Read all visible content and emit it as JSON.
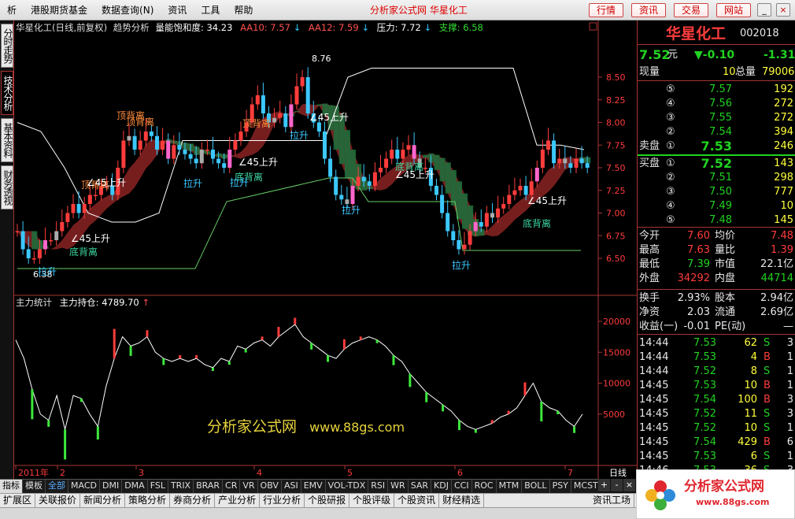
{
  "menu": {
    "items": [
      "析",
      "港股期货基金",
      "数据查询(N)",
      "资讯",
      "工具",
      "帮助"
    ],
    "title": "分析家公式网 华星化工",
    "buttons": [
      "行情",
      "资讯",
      "交易",
      "网站"
    ],
    "window_controls": [
      "_",
      "□",
      "×"
    ]
  },
  "vtabs": [
    "分时走势",
    "技术分析",
    "基本资料",
    "财务透视"
  ],
  "chart_header": {
    "name": "华星化工(日线,前复权)",
    "indicator": "趋势分析",
    "energy_label": "量能饱和度:",
    "energy_value": "34.23",
    "aa10_label": "AA10:",
    "aa10_value": "7.57",
    "aa12_label": "AA12:",
    "aa12_value": "7.59",
    "pressure_label": "压力:",
    "pressure_value": "7.72",
    "support_label": "支撑:",
    "support_value": "6.58",
    "down_arrow": "↓"
  },
  "sub_header": {
    "name": "主力统计",
    "label": "主力持仓:",
    "value": "4789.70",
    "up_arrow": "↑"
  },
  "watermark": {
    "cn": "分析家公式网",
    "url": "www.88gs.com"
  },
  "chart_data": {
    "type": "candlestick",
    "price_axis": {
      "ticks": [
        "8.50",
        "8.25",
        "8.00",
        "7.75",
        "7.50",
        "7.25",
        "7.00",
        "6.75",
        "6.50"
      ],
      "ylim": [
        6.4,
        8.85
      ]
    },
    "sub_axis": {
      "ticks": [
        "20000",
        "15000",
        "10000",
        "5000"
      ],
      "ylim": [
        0,
        23000
      ]
    },
    "x_ticks": [
      "2011年",
      "2",
      "3",
      "4",
      "5",
      "6",
      "7"
    ],
    "period_label": "日线",
    "high_label": "8.76",
    "low_label": "6.38",
    "annotations": {
      "top_div": [
        "顶背离",
        "顶背离",
        "顶背离",
        "顶背离"
      ],
      "bottom_div": [
        "底背离",
        "底背离",
        "底背离",
        "底背离"
      ],
      "pull_up": [
        "拉升",
        "拉升",
        "拉升",
        "拉升",
        "拉升",
        "拉升"
      ],
      "rise45": [
        "∠45上升",
        "∠45上升",
        "∠45上升",
        "∠45上升",
        "∠45上升",
        "∠45上升"
      ]
    },
    "closes": [
      6.8,
      6.6,
      6.5,
      6.5,
      6.6,
      6.7,
      6.7,
      6.8,
      6.9,
      7.0,
      7.1,
      7.0,
      7.1,
      7.2,
      7.2,
      7.3,
      7.3,
      7.2,
      7.5,
      7.8,
      7.85,
      7.7,
      7.8,
      7.9,
      7.85,
      7.7,
      7.8,
      7.6,
      7.75,
      7.7,
      7.65,
      7.6,
      7.55,
      7.7,
      7.7,
      7.6,
      7.55,
      7.5,
      7.7,
      7.8,
      7.9,
      8.0,
      8.2,
      8.3,
      8.1,
      8.0,
      8.05,
      8.1,
      7.95,
      8.2,
      8.4,
      8.5,
      8.1,
      8.0,
      7.9,
      7.6,
      7.4,
      7.2,
      7.15,
      7.1,
      7.3,
      7.4,
      7.35,
      7.3,
      7.45,
      7.5,
      7.6,
      7.7,
      7.6,
      7.7,
      7.75,
      7.6,
      7.5,
      7.5,
      7.3,
      7.2,
      7.0,
      6.8,
      6.7,
      6.6,
      6.65,
      6.8,
      6.9,
      6.85,
      7.0,
      6.95,
      7.05,
      7.1,
      7.2,
      7.25,
      7.3,
      7.2,
      7.35,
      7.5,
      7.7,
      7.8,
      7.55,
      7.6,
      7.55,
      7.5,
      7.6,
      7.55,
      7.5
    ],
    "sub_values": [
      17000,
      14000,
      9000,
      5000,
      4000,
      8000,
      2500,
      8000,
      7500,
      5000,
      3000,
      9500,
      14000,
      17500,
      16000,
      16500,
      17500,
      15000,
      14000,
      13500,
      14000,
      13500,
      14000,
      13000,
      12500,
      14000,
      13500,
      16000,
      15500,
      16500,
      17000,
      16000,
      17500,
      18500,
      19500,
      17500,
      16500,
      15500,
      14500,
      14000,
      15500,
      16500,
      17000,
      17500,
      17000,
      16000,
      14500,
      13500,
      11500,
      10000,
      8500,
      7500,
      6500,
      5500,
      4000,
      3000,
      2500,
      3000,
      3500,
      4500,
      5000,
      6000,
      8000,
      10000,
      7000,
      6000,
      5500,
      4000,
      3000,
      5000
    ],
    "ma_high": [
      8.0,
      7.9,
      7.5,
      7.0,
      6.9,
      6.9,
      7.0,
      7.8,
      7.8,
      7.8,
      7.8,
      7.8,
      7.8,
      7.8,
      8.5,
      8.6,
      8.6,
      8.6,
      8.6,
      8.6,
      8.6,
      8.6,
      7.75,
      7.75,
      7.7
    ]
  },
  "quote": {
    "name": "华星化工",
    "code": "002018",
    "price": "7.52",
    "unit": "元",
    "change": "▼-0.10",
    "pct": "-1.31",
    "vol_now_label": "现量",
    "vol_now": "10",
    "vol_total_label": "总量",
    "vol_total": "79006",
    "sell_label": "卖盘",
    "buy_label": "买盘",
    "asks": [
      {
        "n": "⑤",
        "p": "7.57",
        "v": "192"
      },
      {
        "n": "④",
        "p": "7.56",
        "v": "272"
      },
      {
        "n": "③",
        "p": "7.55",
        "v": "272"
      },
      {
        "n": "②",
        "p": "7.54",
        "v": "394"
      },
      {
        "n": "①",
        "p": "7.53",
        "v": "246"
      }
    ],
    "bids": [
      {
        "n": "①",
        "p": "7.52",
        "v": "143"
      },
      {
        "n": "②",
        "p": "7.51",
        "v": "298"
      },
      {
        "n": "③",
        "p": "7.50",
        "v": "777"
      },
      {
        "n": "④",
        "p": "7.49",
        "v": "10"
      },
      {
        "n": "⑤",
        "p": "7.48",
        "v": "145"
      }
    ],
    "stats": [
      {
        "l1": "今开",
        "v1": "7.60",
        "l2": "均价",
        "v2": "7.48",
        "c1": "red",
        "c2": "red"
      },
      {
        "l1": "最高",
        "v1": "7.63",
        "l2": "量比",
        "v2": "1.39",
        "c1": "red",
        "c2": "red"
      },
      {
        "l1": "最低",
        "v1": "7.39",
        "l2": "市值",
        "v2": "22.1亿",
        "c1": "green",
        "c2": "white"
      },
      {
        "l1": "外盘",
        "v1": "34292",
        "l2": "内盘",
        "v2": "44714",
        "c1": "red",
        "c2": "green"
      }
    ],
    "finance": [
      {
        "l1": "换手",
        "v1": "2.93%",
        "l2": "股本",
        "v2": "2.94亿"
      },
      {
        "l1": "净资",
        "v1": "2.03",
        "l2": "流通",
        "v2": "2.69亿"
      },
      {
        "l1": "收益(一)",
        "v1": "-0.01",
        "l2": "PE(动)",
        "v2": "—"
      }
    ],
    "ticks": [
      {
        "t": "14:44",
        "p": "7.53",
        "v": "62",
        "s": "S",
        "n": "3"
      },
      {
        "t": "14:44",
        "p": "7.53",
        "v": "4",
        "s": "B",
        "n": "1"
      },
      {
        "t": "14:44",
        "p": "7.52",
        "v": "8",
        "s": "S",
        "n": "1"
      },
      {
        "t": "14:45",
        "p": "7.53",
        "v": "10",
        "s": "B",
        "n": "1"
      },
      {
        "t": "14:45",
        "p": "7.54",
        "v": "100",
        "s": "B",
        "n": "3"
      },
      {
        "t": "14:45",
        "p": "7.52",
        "v": "11",
        "s": "S",
        "n": "3"
      },
      {
        "t": "14:45",
        "p": "7.52",
        "v": "10",
        "s": "S",
        "n": "1"
      },
      {
        "t": "14:45",
        "p": "7.54",
        "v": "429",
        "s": "B",
        "n": "6"
      },
      {
        "t": "14:45",
        "p": "7.53",
        "v": "6",
        "s": "S",
        "n": "1"
      },
      {
        "t": "14:46",
        "p": "7.53",
        "v": "36",
        "s": "S",
        "n": "3"
      }
    ]
  },
  "bottom_tabs": [
    "指标",
    "模板",
    "全部",
    "MACD",
    "DMI",
    "DMA",
    "FSL",
    "TRIX",
    "BRAR",
    "CR",
    "VR",
    "OBV",
    "ASI",
    "EMV",
    "VOL-TDX",
    "RSI",
    "WR",
    "SAR",
    "KDJ",
    "CCI",
    "ROC",
    "MTM",
    "BOLL",
    "PSY",
    "MCST"
  ],
  "nav_tabs": [
    "扩展区",
    "关联报价",
    "新闻分析",
    "策略分析",
    "券商分析",
    "产业分析",
    "行业分析",
    "个股研报",
    "个股评级",
    "个股资讯",
    "财经精选",
    "资讯工场"
  ],
  "logo": {
    "title": "分析家公式网",
    "url": "www.88gs.com"
  },
  "scroll_buttons": [
    "+",
    "-",
    "×"
  ]
}
